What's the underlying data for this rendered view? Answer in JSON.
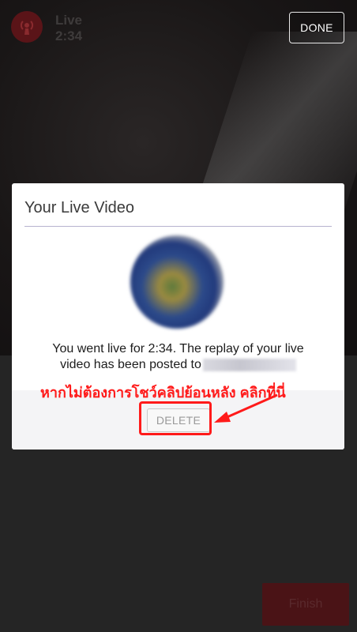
{
  "header": {
    "live_label": "Live",
    "live_time": "2:34",
    "done_label": "DONE"
  },
  "dialog": {
    "title": "Your Live Video",
    "message_line1": "You went live for 2:34. The replay of your live",
    "message_line2": "video has been posted to",
    "delete_label": "DELETE"
  },
  "annotation": {
    "text": "หากไม่ต้องการโชว์คลิปย้อนหลัง คลิกที่นี่"
  },
  "footer": {
    "finish_label": "Finish"
  },
  "colors": {
    "annotation": "#ff1a1a",
    "dialog_bg": "#ffffff",
    "finish_bg": "#4a1316"
  }
}
